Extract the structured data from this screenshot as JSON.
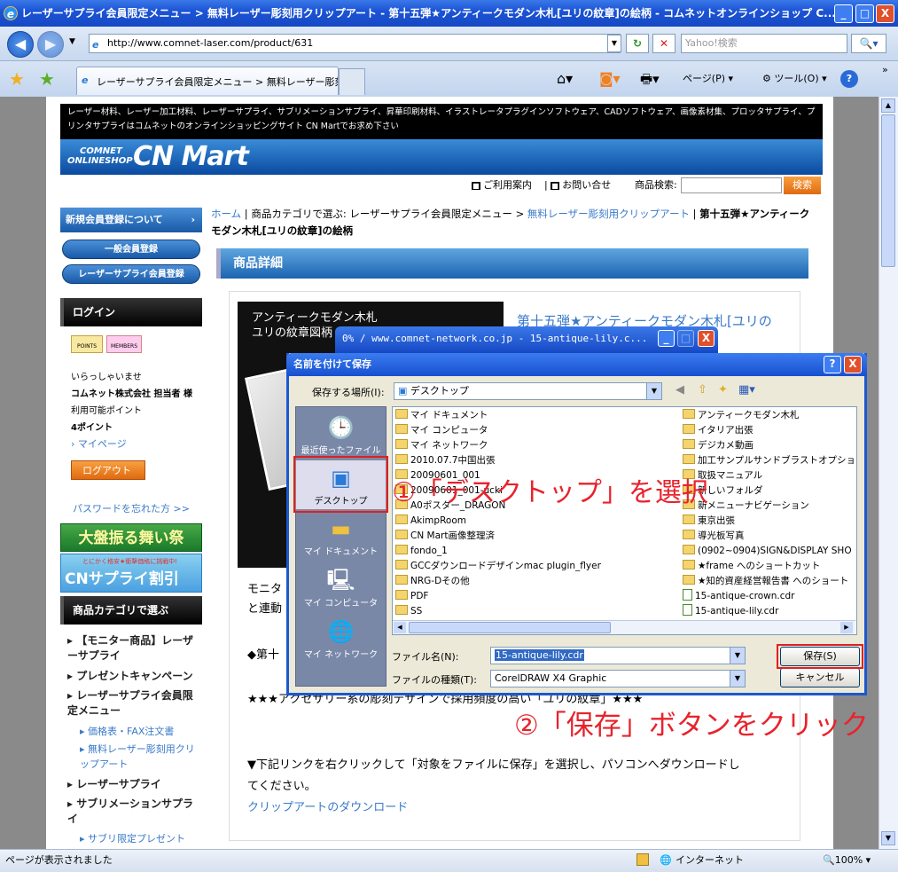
{
  "window": {
    "title": "レーザーサプライ会員限定メニュー > 無料レーザー彫刻用クリップアート - 第十五弾★アンティークモダン木札[ユリの紋章]の絵柄 - コムネットオンラインショップ C...",
    "minimize": "_",
    "maximize": "□",
    "close": "X"
  },
  "nav": {
    "url": "http://www.comnet-laser.com/product/631",
    "search_placeholder": "Yahoo!検索"
  },
  "tabs": {
    "active_label": "レーザーサプライ会員限定メニュー > 無料レーザー彫刻...",
    "page_menu": "ページ(P)",
    "tools_menu": "ツール(O)"
  },
  "site": {
    "header_text": "レーザー材料、レーザー加工材料、レーザーサプライ、サブリメーションサプライ、昇華印刷材料、イラストレータプラグインソフトウェア、CADソフトウェア、画像素材集、プロッタサプライ、プリンタサプライはコムネットのオンラインショッピングサイト CN Martでお求め下さい",
    "logo_small_1": "COMNET",
    "logo_small_2": "ONLINESHOP",
    "logo_big": "CN Mart",
    "util_guide": "ご利用案内",
    "util_contact": "お問い合せ",
    "util_search_label": "商品検索:",
    "util_search_button": "検索"
  },
  "left": {
    "register": "新規会員登録について",
    "general": "一般会員登録",
    "laser": "レーザーサプライ会員登録",
    "login_header": "ログイン",
    "points_badge": "POINTS",
    "members_badge": "MEMBERS",
    "welcome": "いらっしゃいませ",
    "user": "コムネット株式会社 担当者 様",
    "points_label": "利用可能ポイント",
    "points_value": "4ポイント",
    "mypage": "マイページ",
    "logout": "ログアウト",
    "forgot": "パスワードを忘れた方 >>",
    "banner1": "大盤振る舞い祭",
    "banner2": "CNサプライ割引",
    "banner2_small": "とにかく格安★衝撃価格に挑戦中!",
    "category_header": "商品カテゴリで選ぶ",
    "cat1": "【モニター商品】レーザーサプライ",
    "cat2": "プレゼントキャンペーン",
    "cat3": "レーザーサプライ会員限定メニュー",
    "sub1": "価格表・FAX注文書",
    "sub2": "無料レーザー彫刻用クリップアート",
    "cat4": "レーザーサプライ",
    "cat5": "サブリメーションサプライ",
    "sub3": "サブリ限定プレゼント"
  },
  "main": {
    "crumb_home": "ホーム",
    "crumb_cat": "商品カテゴリで選ぶ: レーザーサプライ会員限定メニュー",
    "crumb_clip": "無料レーザー彫刻用クリップアート",
    "crumb_current": "第十五弾★アンティークモダン木札[ユリの紋章]の絵柄",
    "section": "商品詳細",
    "img_caption_1": "アンティークモダン木札",
    "img_caption_2": "ユリの紋章図柄",
    "product_title": "第十五弾★アンティークモダン木札[ユリの",
    "body1": "モニタ",
    "body2": "と連動",
    "body3": "◆第十",
    "body4": "★★★アクセサリー系の彫刻デザインで採用頻度の高い「ユリの紋章」★★★",
    "body5": "▼下記リンクを右クリックして「対象をファイルに保存」を選択し、パソコンへダウンロードし",
    "body6": "てください。",
    "download_link": "クリップアートのダウンロード"
  },
  "progress_dialog": {
    "title": "0% / www.comnet-network.co.jp - 15-antique-lily.c..."
  },
  "save_dialog": {
    "title": "名前を付けて保存",
    "help": "?",
    "close": "X",
    "location_label": "保存する場所(I):",
    "location_value": "デスクトップ",
    "places": [
      "最近使ったファイル",
      "デスクトップ",
      "マイ ドキュメント",
      "マイ コンピュータ",
      "マイ ネットワーク"
    ],
    "files_left": [
      "マイ ドキュメント",
      "マイ コンピュータ",
      "マイ ネットワーク",
      "2010.07.7中国出張",
      "20090601_001",
      "20090601_001-ucki",
      "A0ポスター_DRAGON",
      "AkimpRoom",
      "CN Mart画像整理済",
      "fondo_1",
      "GCCダウンロードデザインmac plugin_flyer",
      "NRG-Dその他",
      "PDF",
      "SS"
    ],
    "files_right": [
      "アンティークモダン木札",
      "イタリア出張",
      "デジカメ動画",
      "加工サンプルサンドブラストオプション_九",
      "取扱マニュアル",
      "新しいフォルダ",
      "新メニューナビゲーション",
      "東京出張",
      "導光板写真",
      "(0902~0904)SIGN&DISPLAY SHO",
      "★frame へのショートカット",
      "★知的資産経営報告書 へのショート",
      "15-antique-crown.cdr",
      "15-antique-lily.cdr"
    ],
    "filename_label": "ファイル名(N):",
    "filename_value": "15-antique-lily.cdr",
    "filetype_label": "ファイルの種類(T):",
    "filetype_value": "CorelDRAW X4 Graphic",
    "save_button": "保存(S)",
    "cancel_button": "キャンセル"
  },
  "annotations": {
    "step1": "①「デスクトップ」を選択",
    "step2": "②「保存」ボタンをクリック"
  },
  "status": {
    "text": "ページが表示されました",
    "zone": "インターネット",
    "zoom": "100%"
  }
}
